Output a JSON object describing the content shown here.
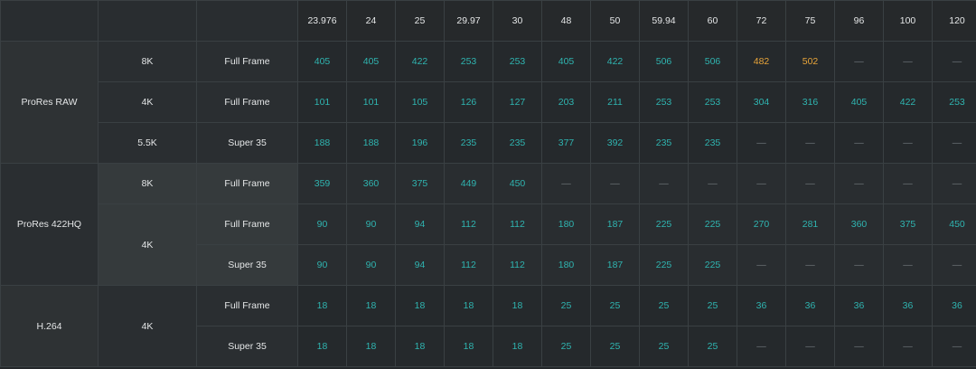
{
  "frame_rates": [
    "23.976",
    "24",
    "25",
    "29.97",
    "30",
    "48",
    "50",
    "59.94",
    "60",
    "72",
    "75",
    "96",
    "100",
    "120"
  ],
  "colors": {
    "value": "#2fb4b0",
    "highlight": "#e7a43a",
    "unavailable": "#6f7679",
    "background": "#23272a"
  },
  "groups": [
    {
      "codec": "ProRes RAW",
      "rows": [
        {
          "resolution": "8K",
          "frame": "Full Frame",
          "values": [
            "405",
            "405",
            "422",
            "253",
            "253",
            "405",
            "422",
            "506",
            "506",
            "482",
            "502",
            "—",
            "—",
            "—"
          ],
          "highlight": [
            9,
            10
          ]
        },
        {
          "resolution": "4K",
          "frame": "Full Frame",
          "values": [
            "101",
            "101",
            "105",
            "126",
            "127",
            "203",
            "211",
            "253",
            "253",
            "304",
            "316",
            "405",
            "422",
            "253"
          ]
        },
        {
          "resolution": "5.5K",
          "frame": "Super 35",
          "values": [
            "188",
            "188",
            "196",
            "235",
            "235",
            "377",
            "392",
            "235",
            "235",
            "—",
            "—",
            "—",
            "—",
            "—"
          ]
        }
      ]
    },
    {
      "codec": "ProRes 422HQ",
      "rows": [
        {
          "resolution": "8K",
          "frame": "Full Frame",
          "values": [
            "359",
            "360",
            "375",
            "449",
            "450",
            "—",
            "—",
            "—",
            "—",
            "—",
            "—",
            "—",
            "—",
            "—"
          ]
        },
        {
          "resolution": "4K",
          "frame": "Full Frame",
          "values": [
            "90",
            "90",
            "94",
            "112",
            "112",
            "180",
            "187",
            "225",
            "225",
            "270",
            "281",
            "360",
            "375",
            "450"
          ],
          "res_span": 2
        },
        {
          "resolution": "4K",
          "frame": "Super 35",
          "values": [
            "90",
            "90",
            "94",
            "112",
            "112",
            "180",
            "187",
            "225",
            "225",
            "—",
            "—",
            "—",
            "—",
            "—"
          ],
          "res_merged": true
        }
      ]
    },
    {
      "codec": "H.264",
      "rows": [
        {
          "resolution": "4K",
          "frame": "Full Frame",
          "values": [
            "18",
            "18",
            "18",
            "18",
            "18",
            "25",
            "25",
            "25",
            "25",
            "36",
            "36",
            "36",
            "36",
            "36"
          ],
          "res_span": 2
        },
        {
          "resolution": "4K",
          "frame": "Super 35",
          "values": [
            "18",
            "18",
            "18",
            "18",
            "18",
            "25",
            "25",
            "25",
            "25",
            "—",
            "—",
            "—",
            "—",
            "—"
          ],
          "res_merged": true
        }
      ]
    }
  ]
}
